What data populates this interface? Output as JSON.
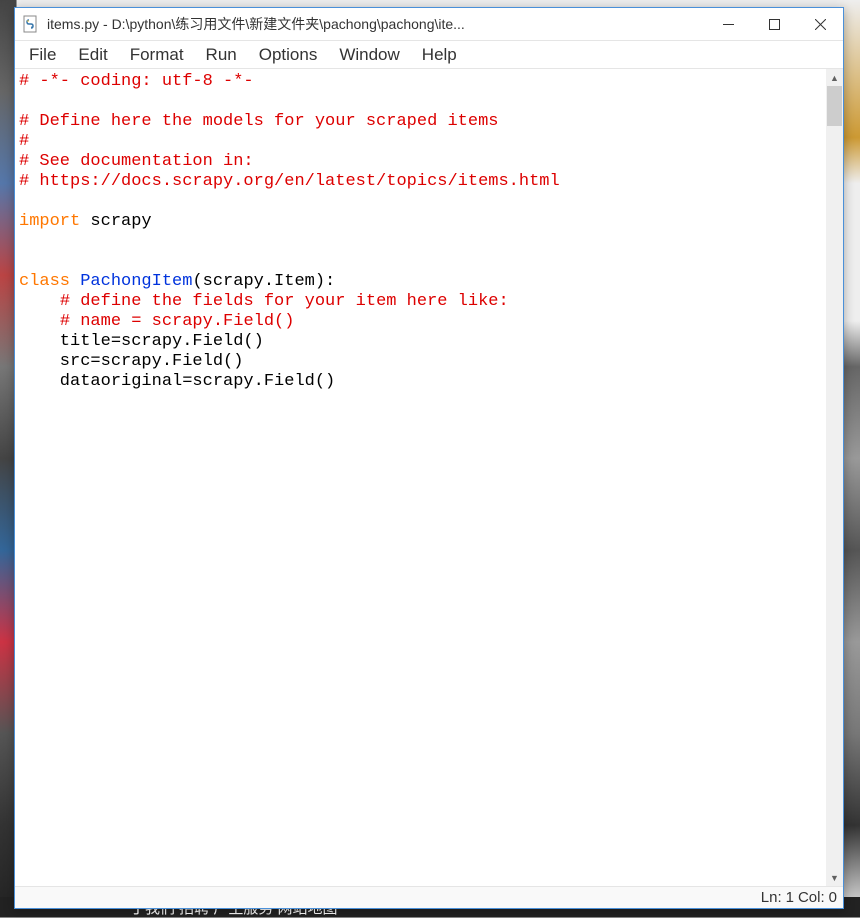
{
  "titlebar": {
    "title": "items.py - D:\\python\\练习用文件\\新建文件夹\\pachong\\pachong\\ite..."
  },
  "menu": {
    "file": "File",
    "edit": "Edit",
    "format": "Format",
    "run": "Run",
    "options": "Options",
    "window": "Window",
    "help": "Help"
  },
  "code": {
    "lines": [
      {
        "tokens": [
          {
            "t": "# -*- coding: utf-8 -*-",
            "c": "comment"
          }
        ]
      },
      {
        "tokens": [
          {
            "t": "",
            "c": "plain"
          }
        ]
      },
      {
        "tokens": [
          {
            "t": "# Define here the models for your scraped items",
            "c": "comment"
          }
        ]
      },
      {
        "tokens": [
          {
            "t": "#",
            "c": "comment"
          }
        ]
      },
      {
        "tokens": [
          {
            "t": "# See documentation in:",
            "c": "comment"
          }
        ]
      },
      {
        "tokens": [
          {
            "t": "# https://docs.scrapy.org/en/latest/topics/items.html",
            "c": "comment"
          }
        ]
      },
      {
        "tokens": [
          {
            "t": "",
            "c": "plain"
          }
        ]
      },
      {
        "tokens": [
          {
            "t": "import",
            "c": "keyword"
          },
          {
            "t": " scrapy",
            "c": "plain"
          }
        ]
      },
      {
        "tokens": [
          {
            "t": "",
            "c": "plain"
          }
        ]
      },
      {
        "tokens": [
          {
            "t": "",
            "c": "plain"
          }
        ]
      },
      {
        "tokens": [
          {
            "t": "class",
            "c": "keyword"
          },
          {
            "t": " ",
            "c": "plain"
          },
          {
            "t": "PachongItem",
            "c": "classname"
          },
          {
            "t": "(scrapy.Item):",
            "c": "plain"
          }
        ]
      },
      {
        "tokens": [
          {
            "t": "    ",
            "c": "plain"
          },
          {
            "t": "# define the fields for your item here like:",
            "c": "comment"
          }
        ]
      },
      {
        "tokens": [
          {
            "t": "    ",
            "c": "plain"
          },
          {
            "t": "# name = scrapy.Field()",
            "c": "comment"
          }
        ]
      },
      {
        "tokens": [
          {
            "t": "    title=scrapy.Field()",
            "c": "plain"
          }
        ]
      },
      {
        "tokens": [
          {
            "t": "    src=scrapy.Field()",
            "c": "plain"
          }
        ]
      },
      {
        "tokens": [
          {
            "t": "    dataoriginal=scrapy.Field()",
            "c": "plain"
          }
        ]
      }
    ]
  },
  "status": {
    "ln_label": "Ln:",
    "ln_value": "1",
    "col_label": "Col:",
    "col_value": "0"
  },
  "bg_bottom_text": "丁我们   招聘   广生服务   网站地图"
}
